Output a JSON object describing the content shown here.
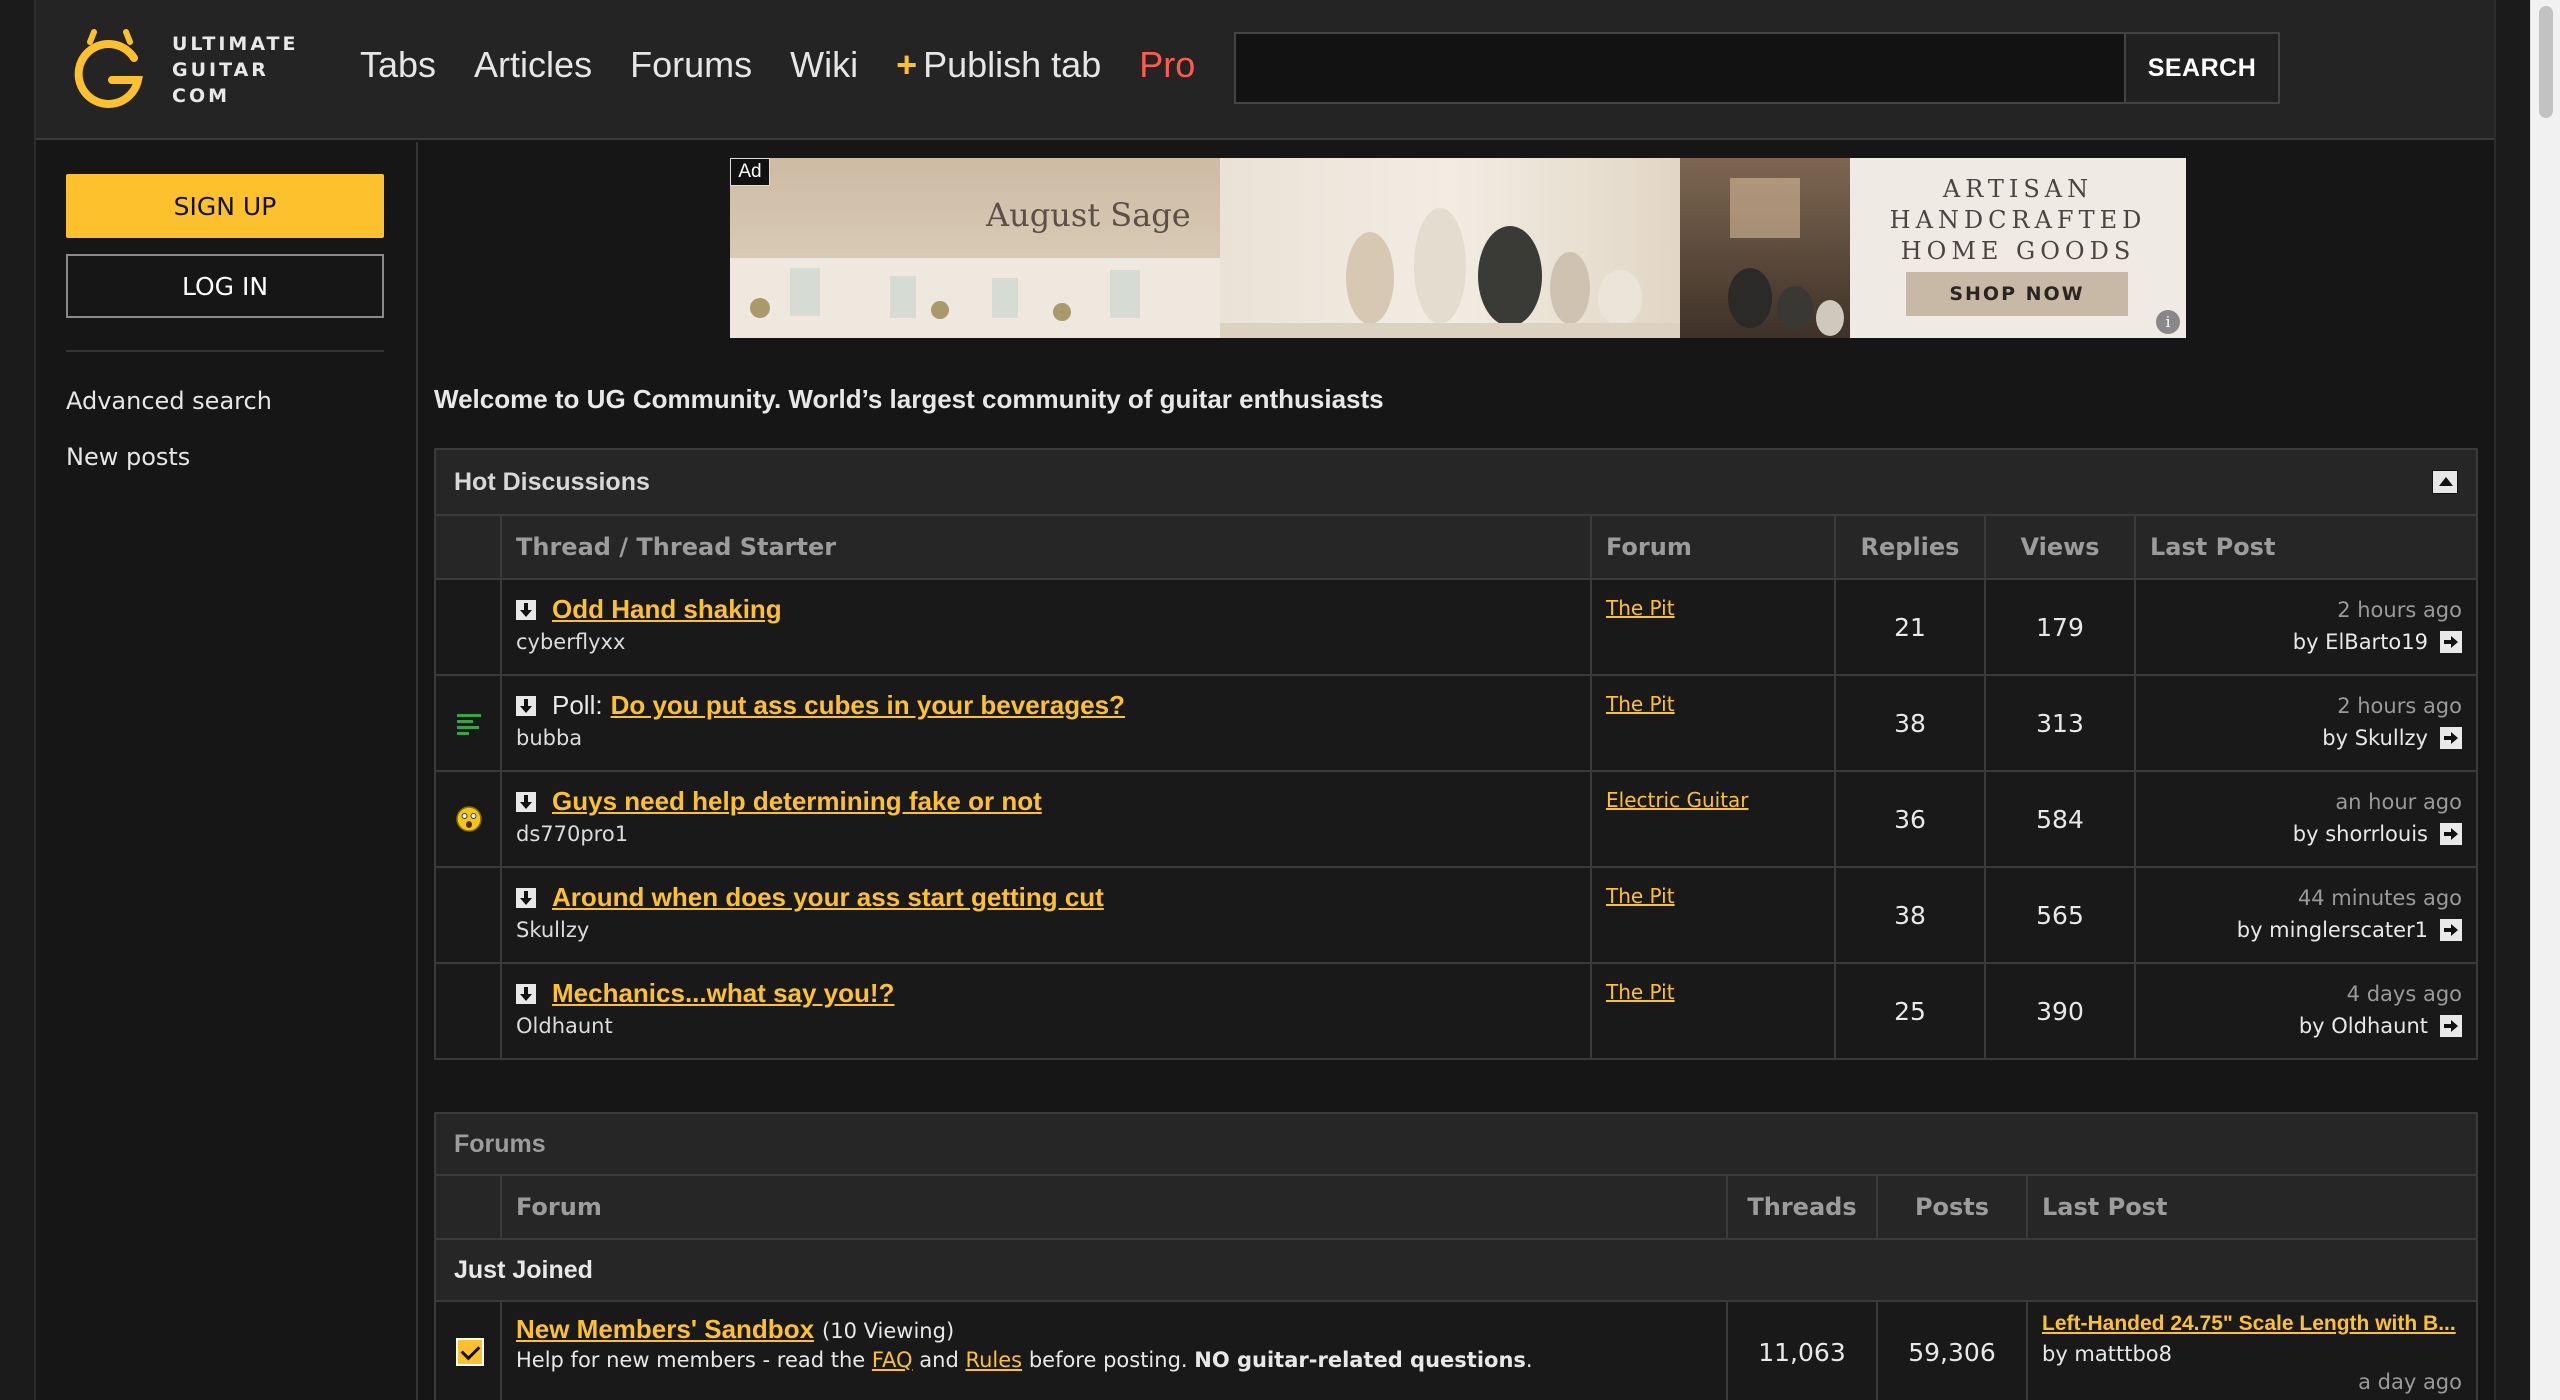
{
  "header": {
    "logo_lines": [
      "ULTIMATE",
      "GUITAR",
      "COM"
    ],
    "nav": [
      {
        "label": "Tabs"
      },
      {
        "label": "Articles"
      },
      {
        "label": "Forums"
      },
      {
        "label": "Wiki"
      },
      {
        "label": "Publish tab",
        "prefix": "+"
      },
      {
        "label": "Pro"
      }
    ],
    "search": {
      "value": "",
      "placeholder": "",
      "button_label": "SEARCH"
    }
  },
  "sidebar": {
    "signup_label": "SIGN UP",
    "login_label": "LOG IN",
    "links": [
      "Advanced search",
      "New posts"
    ]
  },
  "ad": {
    "tag": "Ad",
    "brand": "August Sage",
    "headline_lines": [
      "ARTISAN",
      "HANDCRAFTED",
      "HOME GOODS"
    ],
    "cta": "SHOP NOW",
    "info_icon": "i"
  },
  "welcome": "Welcome to UG Community. World’s largest community of guitar enthusiasts",
  "hot": {
    "title": "Hot Discussions",
    "columns": [
      "Thread / Thread Starter",
      "Forum",
      "Replies",
      "Views",
      "Last Post"
    ],
    "rows": [
      {
        "icon": "",
        "prefix": "",
        "title": "Odd Hand shaking",
        "starter": "cyberflyxx",
        "forum": "The Pit",
        "replies": "21",
        "views": "179",
        "last_time": "2 hours ago",
        "last_by": "by ElBarto19"
      },
      {
        "icon": "poll-lines-icon",
        "prefix": "Poll:",
        "title": "Do you put ass cubes in your beverages?",
        "starter": "bubba",
        "forum": "The Pit",
        "replies": "38",
        "views": "313",
        "last_time": "2 hours ago",
        "last_by": "by Skullzy"
      },
      {
        "icon": "shocked-face-icon",
        "prefix": "",
        "title": "Guys need help determining fake or not",
        "starter": "ds770pro1",
        "forum": "Electric Guitar",
        "replies": "36",
        "views": "584",
        "last_time": "an hour ago",
        "last_by": "by shorrlouis"
      },
      {
        "icon": "",
        "prefix": "",
        "title": "Around when does your ass start getting cut",
        "starter": "Skullzy",
        "forum": "The Pit",
        "replies": "38",
        "views": "565",
        "last_time": "44 minutes ago",
        "last_by": "by minglerscater1"
      },
      {
        "icon": "",
        "prefix": "",
        "title": "Mechanics...what say you!?",
        "starter": "Oldhaunt",
        "forum": "The Pit",
        "replies": "25",
        "views": "390",
        "last_time": "4 days ago",
        "last_by": "by Oldhaunt"
      }
    ]
  },
  "forums": {
    "title": "Forums",
    "columns": [
      "Forum",
      "Threads",
      "Posts",
      "Last Post"
    ],
    "sections": [
      {
        "name": "Just Joined",
        "rows": [
          {
            "title": "New Members' Sandbox",
            "viewing": "(10 Viewing)",
            "desc_pre": "Help for new members - read the",
            "faq": "FAQ",
            "and": "and",
            "rules": "Rules",
            "desc_post": "before posting.",
            "desc_bold": "NO guitar-related questions",
            "desc_end": ".",
            "threads": "11,063",
            "posts": "59,306",
            "last_title": "Left-Handed 24.75\" Scale Length with B...",
            "last_by": "by matttbo8",
            "last_time": "a day ago"
          }
        ]
      }
    ]
  },
  "colors": {
    "accent": "#fec12e",
    "pro": "#ff5a4e",
    "background": "#161616",
    "header": "#242424"
  }
}
